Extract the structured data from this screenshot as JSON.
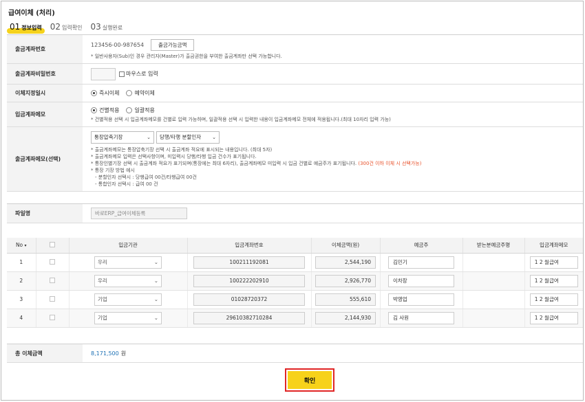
{
  "title": "급여이체 (처리)",
  "steps": [
    {
      "num": "01",
      "label": "정보입력"
    },
    {
      "num": "02",
      "label": "입력확인"
    },
    {
      "num": "03",
      "label": "실행완료"
    }
  ],
  "form": {
    "account": {
      "label": "출금계좌번호",
      "number": "123456-00-987654",
      "button": "출금가능금액",
      "note": "* 일반사용자(Sub)인 경우 관리자(Master)가 출금권한을 부여한 출금계좌만 선택 가능합니다."
    },
    "password": {
      "label": "출금계좌비밀번호",
      "mouse_input": "마우스로 입력"
    },
    "schedule": {
      "label": "이체지정일시",
      "opt1": "즉시이체",
      "opt2": "예약이체"
    },
    "deposit_memo": {
      "label": "입금계좌메모",
      "opt1": "건별적용",
      "opt2": "일괄적용",
      "note": "* 건별적용 선택 시 입금계좌메모를 건별로 입력 가능하며, 일괄적용 선택 시 입력한 내용이 입금계좌메모 전체에 적용됩니다.(최대 10자리 입력 가능)"
    },
    "withdraw_memo": {
      "label": "출금계좌메모(선택)",
      "select1": "통장압축기장",
      "select2": "당행/타행 분할인자",
      "notes": [
        "* 출금계좌메모는 통장압축기장 선택 시 출금계좌 적요에 표시되는 내용입니다. (최대 5자)",
        "* 출금계좌메모 입력은 선택사항이며, 미입력시 당행/타행 입금 건수가 표기됩니다.",
        "* 통장인별기장 선택 시 출금계좌 적요가 표기되며(통장에는 최대 6자리), 출금계좌메모 미입력 시 입금 건별로 예금주가 표기됩니다.",
        "* 통장 기장 방법 예시",
        "- 분할인자 선택시 : 당행급여 00건/타행급여 00건",
        "- 통합인자 선택시 : 급여 00 건"
      ],
      "red_note": "(300건 이하 이체 시 선택가능)"
    },
    "file": {
      "label": "파일명",
      "value": "바로ERP_급여이체등록"
    }
  },
  "table": {
    "headers": [
      "No",
      "",
      "입금기관",
      "입금계좌번호",
      "이체금액(원)",
      "예금주",
      "받는분예금주명",
      "입금계좌메모"
    ],
    "rows": [
      {
        "no": "1",
        "bank": "우리",
        "account": "100211192081",
        "amount": "2,544,190",
        "holder": "김민기",
        "memo": "1 2 월급여"
      },
      {
        "no": "2",
        "bank": "우리",
        "account": "100222202910",
        "amount": "2,926,770",
        "holder": "이차장",
        "memo": "1 2 월급여"
      },
      {
        "no": "3",
        "bank": "기업",
        "account": "01028720372",
        "amount": "555,610",
        "holder": "박영업",
        "memo": "1 2 월급여"
      },
      {
        "no": "4",
        "bank": "기업",
        "account": "29610382710284",
        "amount": "2,144,930",
        "holder": "김 사원",
        "memo": "1 2 월급여"
      }
    ]
  },
  "total": {
    "label": "총 이체금액",
    "amount": "8,171,500",
    "unit": "원"
  },
  "confirm_label": "확인",
  "colors": {
    "accent": "#f7d21a",
    "highlight_border": "#e02424",
    "amount": "#1a6fb4"
  }
}
